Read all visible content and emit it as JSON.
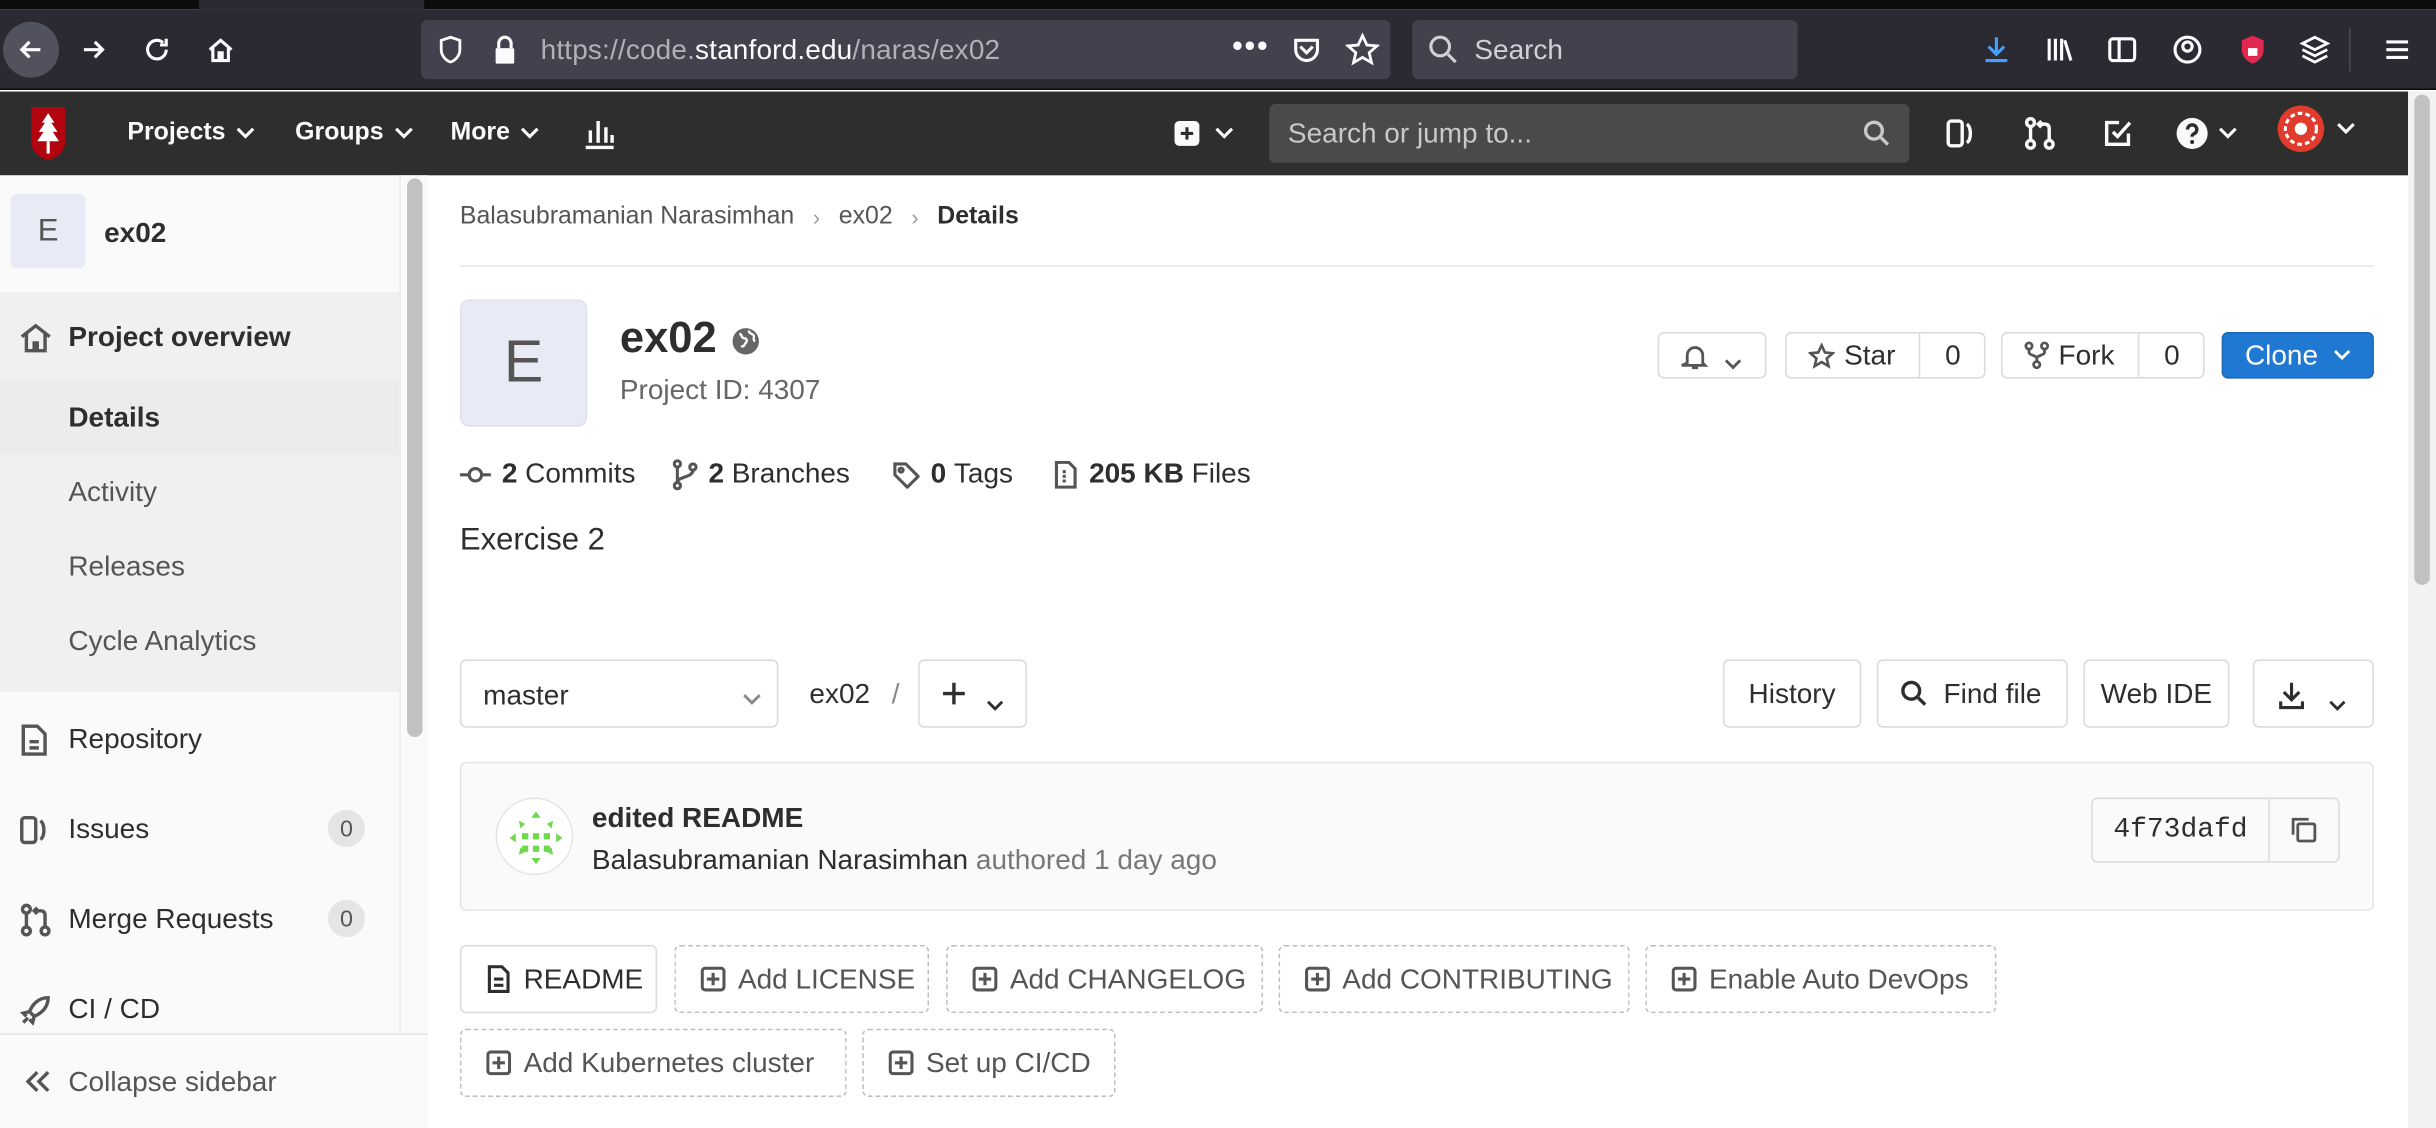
{
  "browser": {
    "url_prefix": "https://code.",
    "url_domain": "stanford.edu",
    "url_path": "/naras/ex02",
    "search_placeholder": "Search"
  },
  "header": {
    "nav": [
      {
        "label": "Projects"
      },
      {
        "label": "Groups"
      },
      {
        "label": "More"
      }
    ],
    "search_placeholder": "Search or jump to..."
  },
  "sidebar": {
    "project_initial": "E",
    "project_name": "ex02",
    "overview_label": "Project overview",
    "overview_items": [
      {
        "label": "Details"
      },
      {
        "label": "Activity"
      },
      {
        "label": "Releases"
      },
      {
        "label": "Cycle Analytics"
      }
    ],
    "repository_label": "Repository",
    "issues_label": "Issues",
    "issues_count": "0",
    "merge_label": "Merge Requests",
    "merge_count": "0",
    "cicd_label": "CI / CD",
    "collapse_label": "Collapse sidebar"
  },
  "breadcrumb": {
    "owner": "Balasubramanian Narasimhan",
    "project": "ex02",
    "current": "Details"
  },
  "project": {
    "initial": "E",
    "name": "ex02",
    "id_text": "Project ID: 4307",
    "star_label": "Star",
    "star_count": "0",
    "fork_label": "Fork",
    "fork_count": "0",
    "clone_label": "Clone",
    "description": "Exercise 2"
  },
  "stats": {
    "commits_num": "2",
    "commits_label": "Commits",
    "branches_num": "2",
    "branches_label": "Branches",
    "tags_num": "0",
    "tags_label": "Tags",
    "files_num": "205 KB",
    "files_label": "Files"
  },
  "tree": {
    "branch": "master",
    "path": "ex02",
    "sep": "/",
    "history_label": "History",
    "findfile_label": "Find file",
    "webide_label": "Web IDE"
  },
  "commit": {
    "title": "edited README",
    "author": "Balasubramanian Narasimhan",
    "meta": "authored 1 day ago",
    "sha": "4f73dafd"
  },
  "quick_actions": {
    "readme": "README",
    "license": "Add LICENSE",
    "changelog": "Add CHANGELOG",
    "contributing": "Add CONTRIBUTING",
    "autodevops": "Enable Auto DevOps",
    "kubernetes": "Add Kubernetes cluster",
    "cicd": "Set up CI/CD"
  },
  "colors": {
    "header_bg": "#2e2e2e",
    "browser_bg": "#2b2a33",
    "clone_blue": "#1f78d1",
    "stanford_red": "#b1040e"
  }
}
